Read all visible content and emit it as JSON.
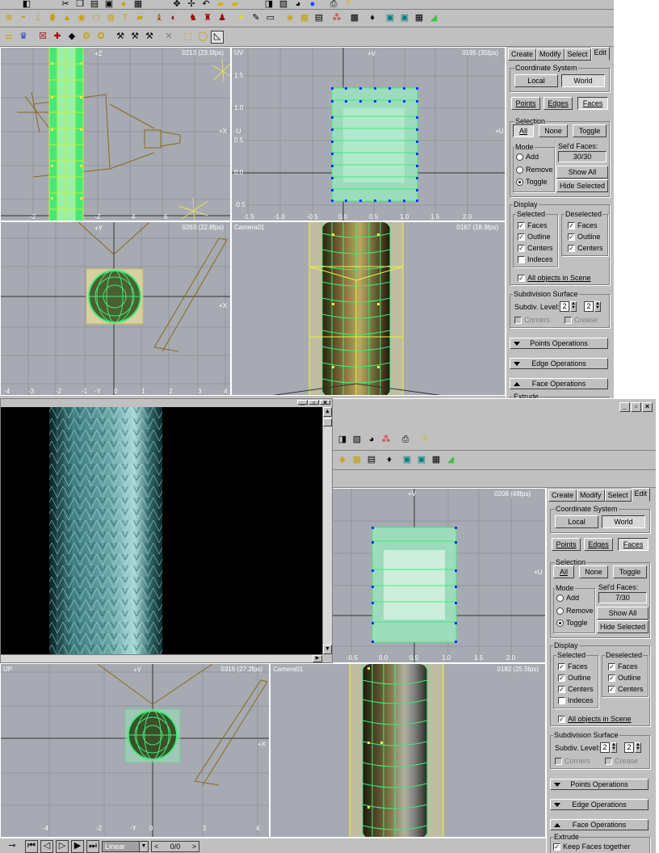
{
  "window1": {
    "viewports": {
      "top": {
        "hdr_left": "",
        "hdr_right": "0213  (23.5fps)",
        "axes": [
          "+Z",
          "+X",
          "-Z"
        ],
        "ticks": [
          "-2",
          "0",
          "2",
          "4",
          "6"
        ]
      },
      "uv": {
        "hdr_left": "UV",
        "hdr_right": "0195  (35fps)",
        "axes": [
          "+V",
          "-U",
          "+U"
        ],
        "yticks": [
          "1.5",
          "1.0",
          "0.5",
          "0.0",
          "-0.5"
        ],
        "xticks": [
          "-1.5",
          "-1.0",
          "-0.5",
          "0.0",
          "0.5",
          "1.0",
          "1.5",
          "2.0"
        ]
      },
      "front": {
        "hdr_left": "",
        "hdr_right": "0263  (22.8fps)",
        "axes": [
          "+Y",
          "+X",
          "-Y"
        ],
        "ticks": [
          "-4",
          "-3",
          "-2",
          "-1",
          "0",
          "1",
          "2",
          "3",
          "4"
        ]
      },
      "camera": {
        "hdr_left": "Camera01",
        "hdr_right": "0167  (18.9fps)"
      }
    },
    "panel": {
      "tabs": [
        "Create",
        "Modify",
        "Select",
        "Edit"
      ],
      "coord_title": "Coordinate System",
      "coord_local": "Local",
      "coord_world": "World",
      "points": "Points",
      "edges": "Edges",
      "faces": "Faces",
      "selection_title": "Selection",
      "sel_all": "All",
      "sel_none": "None",
      "sel_toggle": "Toggle",
      "mode_title": "Mode",
      "mode_add": "Add",
      "mode_remove": "Remove",
      "mode_toggle": "Toggle",
      "seld_label": "Sel'd Faces:",
      "seld_value": "30/30",
      "show_all": "Show All",
      "hide_selected": "Hide Selected",
      "display_title": "Display",
      "selected_title": "Selected",
      "deselected_title": "Deselected",
      "d_faces": "Faces",
      "d_outline": "Outline",
      "d_centers": "Centers",
      "d_indeces": "Indeces",
      "all_objects": "All objects in Scene",
      "subdiv_title": "Subdivision Surface",
      "subdiv_label": "Subdiv. Level:",
      "subdiv_a": "2",
      "subdiv_b": "2",
      "corners": "Corners",
      "crease": "Crease",
      "points_ops": "Points Operations",
      "edge_ops": "Edge Operations",
      "face_ops": "Face Operations",
      "extrude": "Extrude"
    }
  },
  "window2": {
    "viewports": {
      "uv": {
        "hdr_left": "",
        "hdr_right": "0208  (48fps)",
        "axes": [
          "+V",
          "+U"
        ],
        "xticks": [
          "-0.5",
          "0.0",
          "0.5",
          "1.0",
          "1.5",
          "2.0"
        ]
      },
      "front": {
        "hdr_left": "UP",
        "hdr_right": "0316  (27.2fps)",
        "axes": [
          "+Y",
          "+X",
          "-Y"
        ],
        "ticks": [
          "-4",
          "-2",
          "0",
          "2",
          "4"
        ]
      },
      "camera": {
        "hdr_left": "Camera01",
        "hdr_right": "0182  (25.5fps)"
      }
    },
    "panel": {
      "tabs": [
        "Create",
        "Modify",
        "Select",
        "Edit"
      ],
      "coord_title": "Coordinate System",
      "coord_local": "Local",
      "coord_world": "World",
      "points": "Points",
      "edges": "Edges",
      "faces": "Faces",
      "selection_title": "Selection",
      "sel_all": "All",
      "sel_none": "None",
      "sel_toggle": "Toggle",
      "mode_title": "Mode",
      "mode_add": "Add",
      "mode_remove": "Remove",
      "mode_toggle": "Toggle",
      "seld_label": "Sel'd Faces:",
      "seld_value": "7/30",
      "show_all": "Show All",
      "hide_selected": "Hide Selected",
      "display_title": "Display",
      "selected_title": "Selected",
      "deselected_title": "Deselected",
      "d_faces": "Faces",
      "d_outline": "Outline",
      "d_centers": "Centers",
      "d_indeces": "Indeces",
      "all_objects": "All objects in Scene",
      "subdiv_title": "Subdivision Surface",
      "subdiv_label": "Subdiv. Level:",
      "subdiv_a": "2",
      "subdiv_b": "2",
      "corners": "Corners",
      "crease": "Crease",
      "points_ops": "Points Operations",
      "edge_ops": "Edge Operations",
      "face_ops": "Face Operations",
      "extrude": "Extrude",
      "keep_faces": "Keep Faces together"
    },
    "statusbar": {
      "anim_mode": "Linear",
      "frame": "0/0"
    }
  },
  "colors": {
    "viewport_bg": "#a7aab2",
    "grid_line": "#9095a0",
    "mesh_green": "#45e87a",
    "mesh_outline": "#c8f040",
    "wire_olive": "#8a6a1a",
    "uv_fill": "#9cdcbc",
    "vertex_blue": "#1030ff"
  }
}
